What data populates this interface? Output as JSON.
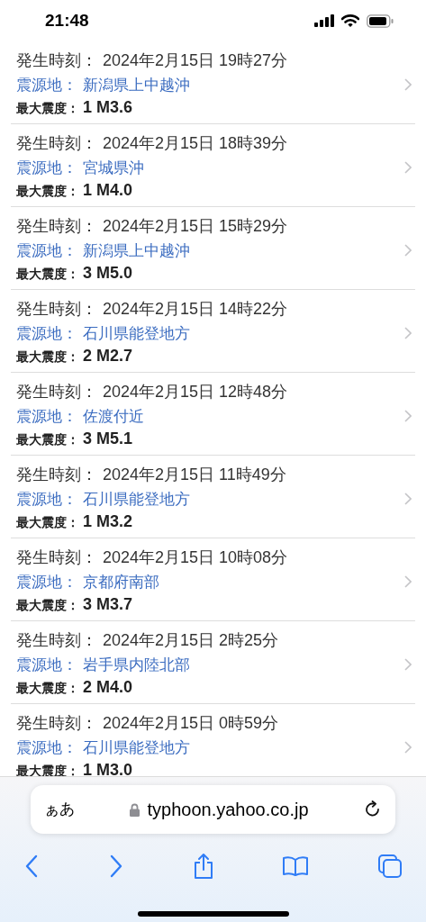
{
  "status_bar": {
    "time": "21:48"
  },
  "quakes": [
    {
      "time_label": "発生時刻：",
      "time": "2024年2月15日 19時27分",
      "epicenter_label": "震源地：",
      "epicenter": "新潟県上中越沖",
      "intensity_label": "最大震度：",
      "intensity": "1 M3.6"
    },
    {
      "time_label": "発生時刻：",
      "time": "2024年2月15日 18時39分",
      "epicenter_label": "震源地：",
      "epicenter": "宮城県沖",
      "intensity_label": "最大震度：",
      "intensity": "1 M4.0"
    },
    {
      "time_label": "発生時刻：",
      "time": "2024年2月15日 15時29分",
      "epicenter_label": "震源地：",
      "epicenter": "新潟県上中越沖",
      "intensity_label": "最大震度：",
      "intensity": "3 M5.0"
    },
    {
      "time_label": "発生時刻：",
      "time": "2024年2月15日 14時22分",
      "epicenter_label": "震源地：",
      "epicenter": "石川県能登地方",
      "intensity_label": "最大震度：",
      "intensity": "2 M2.7"
    },
    {
      "time_label": "発生時刻：",
      "time": "2024年2月15日 12時48分",
      "epicenter_label": "震源地：",
      "epicenter": "佐渡付近",
      "intensity_label": "最大震度：",
      "intensity": "3 M5.1"
    },
    {
      "time_label": "発生時刻：",
      "time": "2024年2月15日 11時49分",
      "epicenter_label": "震源地：",
      "epicenter": "石川県能登地方",
      "intensity_label": "最大震度：",
      "intensity": "1 M3.2"
    },
    {
      "time_label": "発生時刻：",
      "time": "2024年2月15日 10時08分",
      "epicenter_label": "震源地：",
      "epicenter": "京都府南部",
      "intensity_label": "最大震度：",
      "intensity": "3 M3.7"
    },
    {
      "time_label": "発生時刻：",
      "time": "2024年2月15日 2時25分",
      "epicenter_label": "震源地：",
      "epicenter": "岩手県内陸北部",
      "intensity_label": "最大震度：",
      "intensity": "2 M4.0"
    },
    {
      "time_label": "発生時刻：",
      "time": "2024年2月15日 0時59分",
      "epicenter_label": "震源地：",
      "epicenter": "石川県能登地方",
      "intensity_label": "最大震度：",
      "intensity": "1 M3.0"
    }
  ],
  "browser": {
    "text_size_button": "ぁあ",
    "url": "typhoon.yahoo.co.jp"
  }
}
